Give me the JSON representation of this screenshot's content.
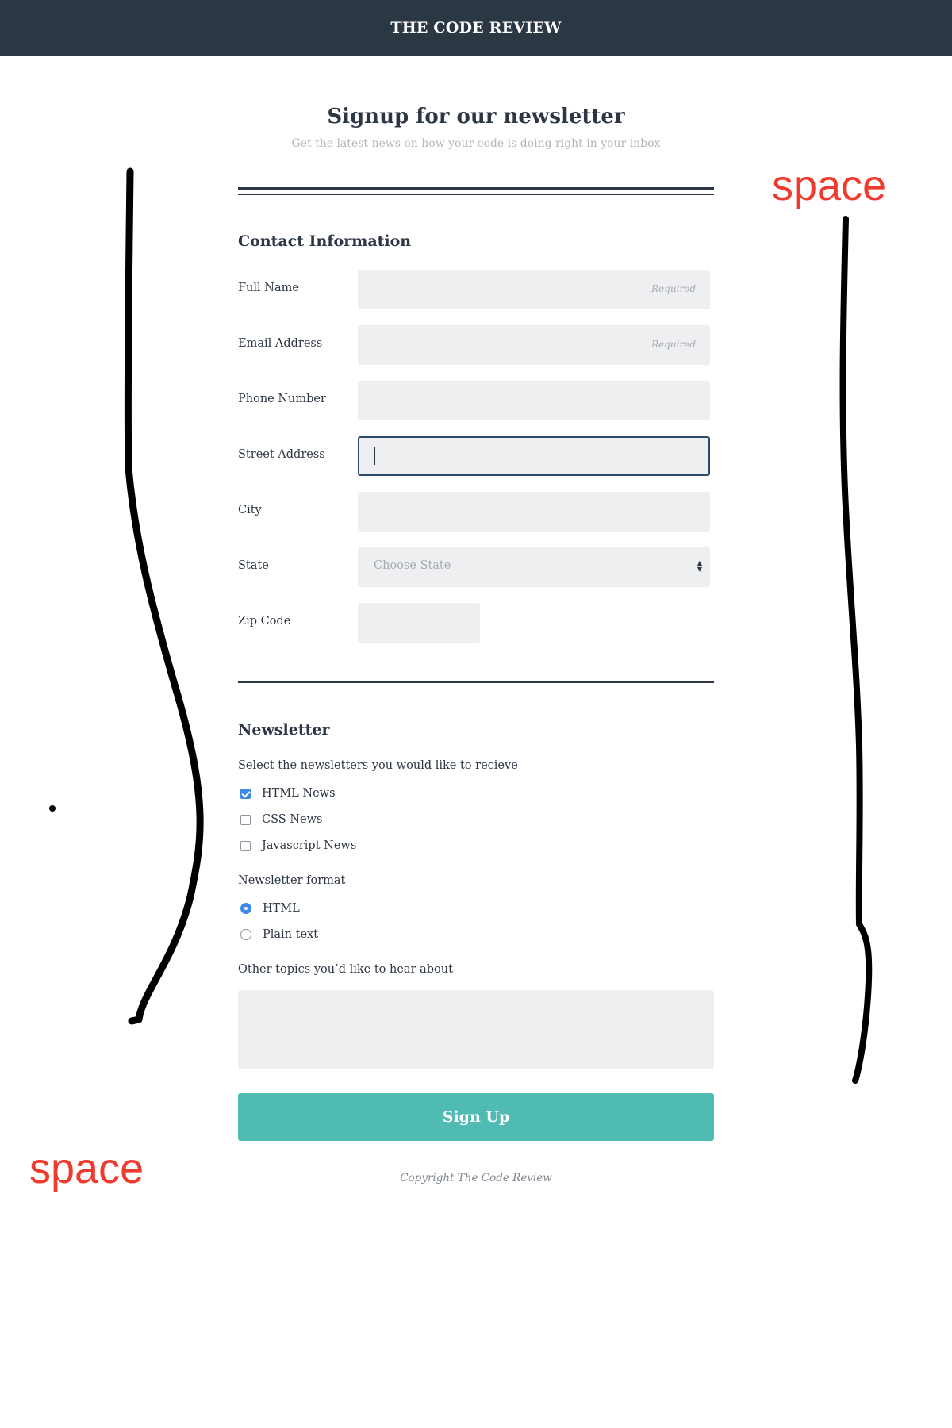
{
  "header": {
    "title": "THE CODE REVIEW"
  },
  "intro": {
    "title": "Signup for our newsletter",
    "subtitle": "Get the latest news on how your code is doing right in your inbox"
  },
  "contact": {
    "heading": "Contact Information",
    "fields": {
      "full_name": {
        "label": "Full Name",
        "value": "",
        "hint": "Required"
      },
      "email": {
        "label": "Email Address",
        "value": "",
        "hint": "Required"
      },
      "phone": {
        "label": "Phone Number",
        "value": ""
      },
      "street": {
        "label": "Street Address",
        "value": ""
      },
      "city": {
        "label": "City",
        "value": ""
      },
      "state": {
        "label": "State",
        "selected": "Choose State"
      },
      "zip": {
        "label": "Zip Code",
        "value": ""
      }
    }
  },
  "newsletter": {
    "heading": "Newsletter",
    "select_prompt": "Select the newsletters you would like to recieve",
    "options": [
      {
        "label": "HTML News",
        "checked": true
      },
      {
        "label": "CSS News",
        "checked": false
      },
      {
        "label": "Javascript News",
        "checked": false
      }
    ],
    "format_prompt": "Newsletter format",
    "formats": [
      {
        "label": "HTML",
        "checked": true
      },
      {
        "label": "Plain text",
        "checked": false
      }
    ],
    "topics_prompt": "Other topics you’d like to hear about",
    "topics_value": ""
  },
  "submit_label": "Sign Up",
  "footer": {
    "copyright": "Copyright The Code Review"
  },
  "annotations": {
    "left_label": "space",
    "right_label": "space"
  },
  "colors": {
    "header_bg": "#2c3744",
    "accent_button": "#4fbbb2",
    "checkbox_checked": "#3c89e8",
    "annotation_red": "#ee3b2e"
  }
}
